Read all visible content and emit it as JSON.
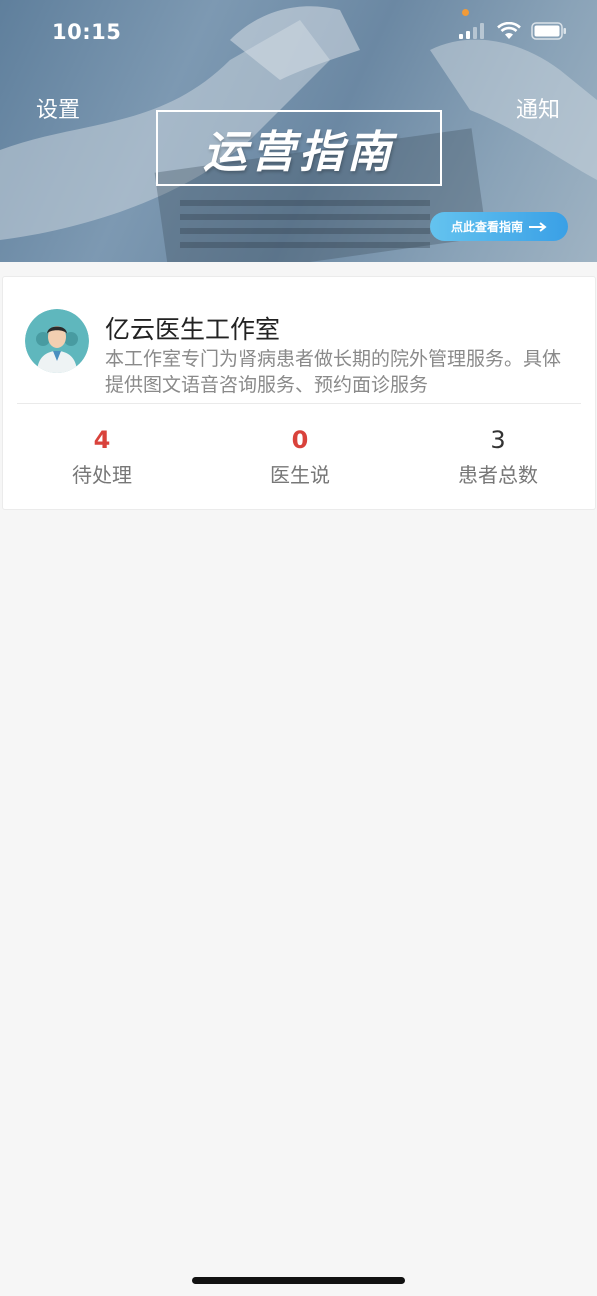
{
  "status_bar": {
    "time": "10:15"
  },
  "header": {
    "settings_label": "设置",
    "notify_label": "通知",
    "banner_title": "运营指南",
    "guide_button_label": "点此查看指南"
  },
  "studio": {
    "name": "亿云医生工作室",
    "description": "本工作室专门为肾病患者做长期的院外管理服务。具体提供图文语音咨询服务、预约面诊服务"
  },
  "stats": [
    {
      "value": "4",
      "label": "待处理"
    },
    {
      "value": "0",
      "label": "医生说"
    },
    {
      "value": "3",
      "label": "患者总数"
    }
  ],
  "colors": {
    "accent_red": "#d9423b",
    "guide_button": "#3aa0e6",
    "background": "#f6f6f6"
  }
}
